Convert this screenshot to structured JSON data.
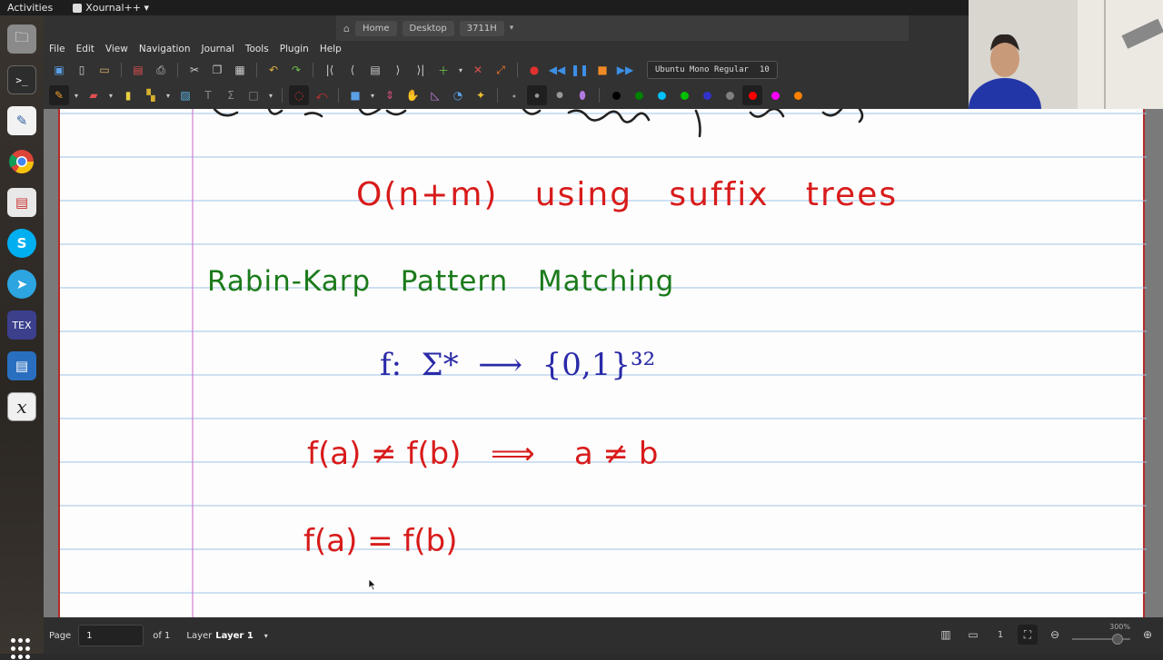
{
  "topbar": {
    "activities": "Activities",
    "app_name": "Xournal++ ▾"
  },
  "pathbar": {
    "crumbs": [
      "Home",
      "Desktop",
      "3711H"
    ]
  },
  "menu": [
    "File",
    "Edit",
    "View",
    "Navigation",
    "Journal",
    "Tools",
    "Plugin",
    "Help"
  ],
  "toolbar": {
    "font_name": "Ubuntu Mono Regular",
    "font_size": "10",
    "palette": [
      "#000000",
      "#008000",
      "#00c0ff",
      "#00c000",
      "#3333cc",
      "#808080",
      "#ff0000",
      "#ff00ff",
      "#ff8000"
    ]
  },
  "notebook": {
    "lines": [
      {
        "text": "O(n+m)   using   suffix   trees",
        "color": "#d81b1b"
      },
      {
        "text": "Rabin-Karp   Pattern   Matching",
        "color": "#1b7a1b"
      },
      {
        "text": "f:  Σ*  ⟶  {0,1}³²",
        "color": "#2a2aa8"
      },
      {
        "text": "f(a) ≠ f(b)   ⟹    a ≠ b",
        "color": "#d81b1b"
      },
      {
        "text": "f(a) = f(b)",
        "color": "#d81b1b"
      }
    ]
  },
  "status": {
    "page_label": "Page",
    "page_value": "1",
    "of_label": "of 1",
    "layer_label": "Layer",
    "layer_value": "Layer 1",
    "zoom": "300%"
  }
}
